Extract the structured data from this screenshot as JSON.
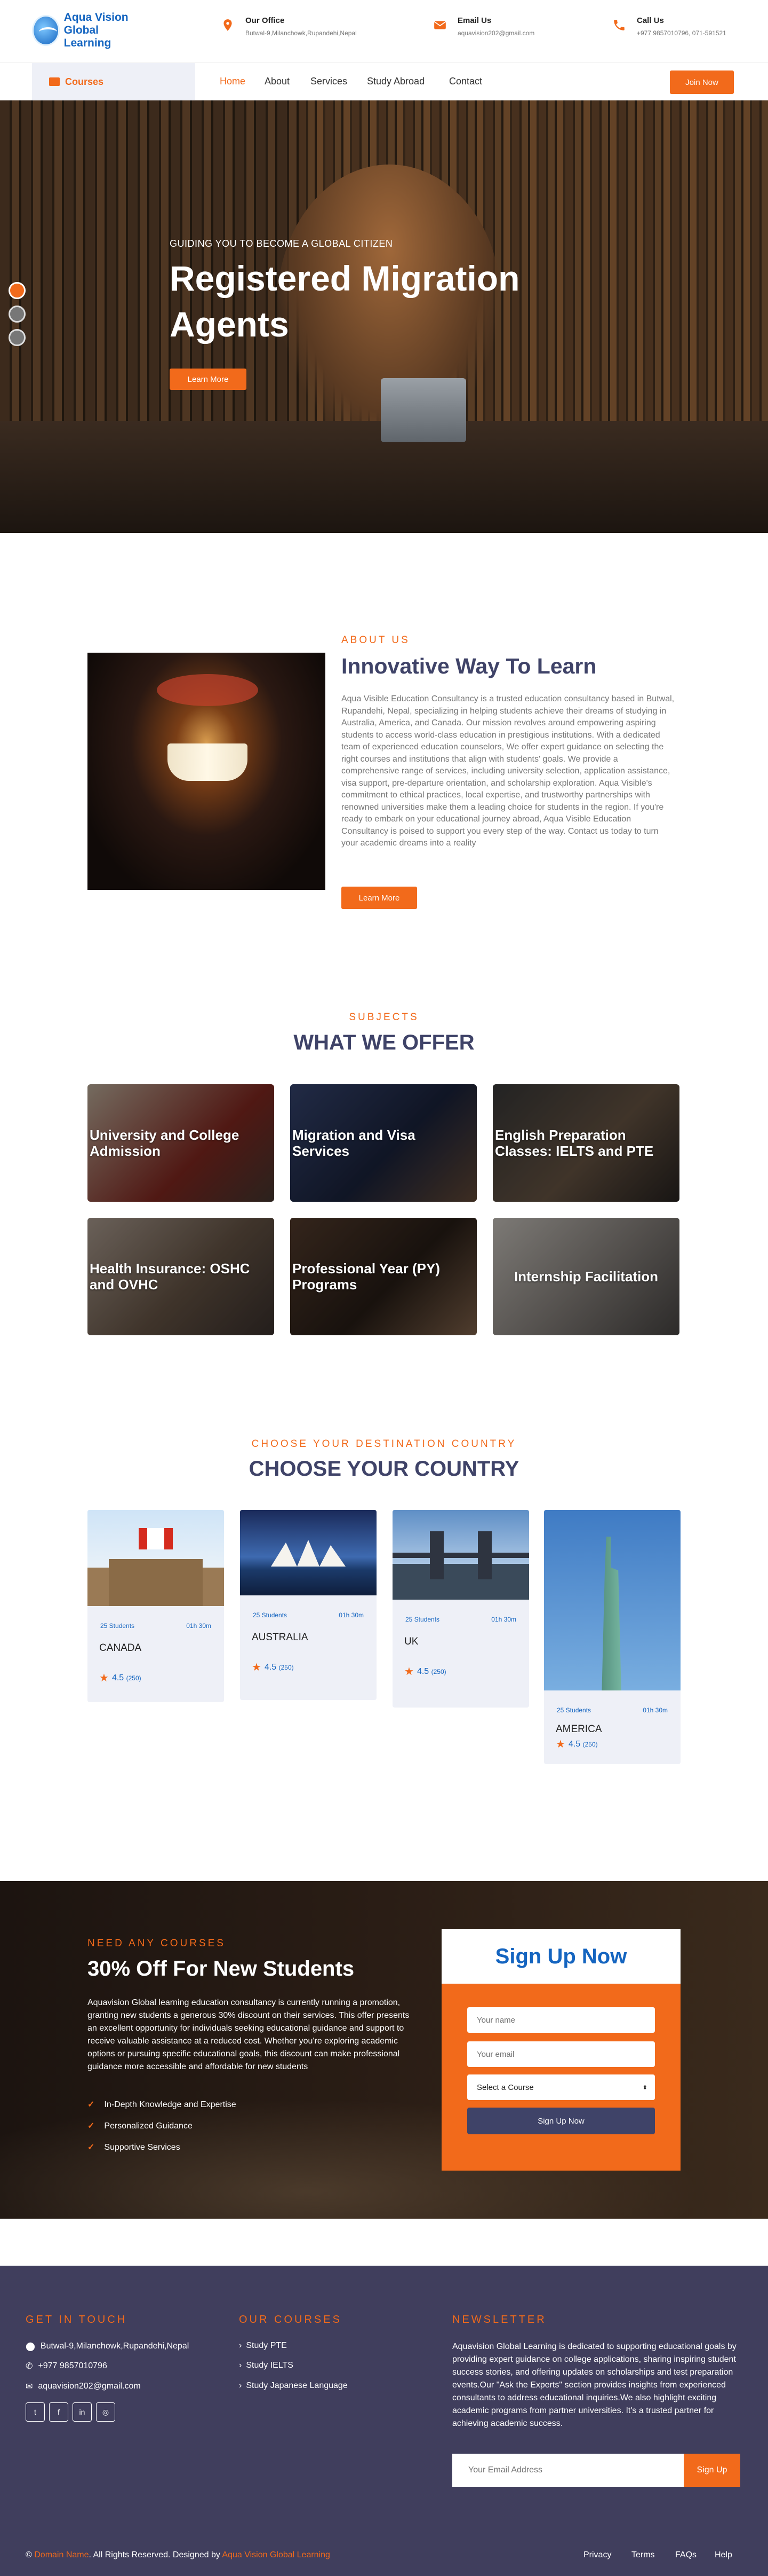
{
  "brand": {
    "name_line1": "Aqua Vision",
    "name_line2": "Global Learning"
  },
  "topbar": {
    "office": {
      "title": "Our Office",
      "value": "Butwal-9,Milanchowk,Rupandehi,Nepal"
    },
    "email": {
      "title": "Email Us",
      "value": "aquavision202@gmail.com"
    },
    "call": {
      "title": "Call Us",
      "value": "+977 9857010796, 071-591521"
    }
  },
  "nav": {
    "courses": "Courses",
    "items": [
      "Home",
      "About",
      "Services",
      "Study Abroad",
      "Contact"
    ],
    "join": "Join Now",
    "colors": {
      "accent": "#f26a1b",
      "brand": "#1565c0",
      "dark": "#403e5d"
    }
  },
  "hero": {
    "subtitle": "GUIDING YOU TO BECOME A GLOBAL CITIZEN",
    "title": "Registered Migration Agents",
    "button": "Learn More",
    "slide_count": 3,
    "active_slide": 1
  },
  "about": {
    "tag": "ABOUT US",
    "title": "Innovative Way To Learn",
    "text": "Aqua Visible Education Consultancy is a trusted education consultancy based in Butwal, Rupandehi, Nepal, specializing in helping students achieve their dreams of studying in Australia, America, and Canada. Our mission revolves around empowering aspiring students to access world-class education in prestigious institutions. With a dedicated team of experienced education counselors, We offer expert guidance on selecting the right courses and institutions that align with students' goals. We provide a comprehensive range of services, including university selection, application assistance, visa support, pre-departure orientation, and scholarship exploration. Aqua Visible's commitment to ethical practices, local expertise, and trustworthy partnerships with renowned universities make them a leading choice for students in the region. If you're ready to embark on your educational journey abroad, Aqua Visible Education Consultancy is poised to support you every step of the way. Contact us today to turn your academic dreams into a reality",
    "button": "Learn More"
  },
  "offer": {
    "tag": "SUBJECTS",
    "title": "WHAT WE OFFER",
    "cards": [
      {
        "label": "University and College Admission"
      },
      {
        "label": "Migration and Visa Services"
      },
      {
        "label": "English Preparation Classes: IELTS and PTE"
      },
      {
        "label": "Health Insurance: OSHC and OVHC"
      },
      {
        "label": "Professional Year (PY) Programs"
      },
      {
        "label": "Internship Facilitation"
      }
    ]
  },
  "countries": {
    "tag": "CHOOSE YOUR DESTINATION COUNTRY",
    "title": "CHOOSE YOUR COUNTRY",
    "cards": [
      {
        "name": "CANADA",
        "students": "25 Students",
        "duration": "01h 30m",
        "rating": "4.5",
        "reviews": "(250)"
      },
      {
        "name": "AUSTRALIA",
        "students": "25 Students",
        "duration": "01h 30m",
        "rating": "4.5",
        "reviews": "(250)"
      },
      {
        "name": "UK",
        "students": "25 Students",
        "duration": "01h 30m",
        "rating": "4.5",
        "reviews": "(250)"
      },
      {
        "name": "AMERICA",
        "students": "25 Students",
        "duration": "01h 30m",
        "rating": "4.5",
        "reviews": "(250)"
      }
    ]
  },
  "promo": {
    "tag": "NEED ANY COURSES",
    "title": "30% Off For New Students",
    "text": "Aquavision Global learning education consultancy is currently running a promotion, granting new students a generous 30% discount on their services. This offer presents an excellent opportunity for individuals seeking educational guidance and support to receive valuable assistance at a reduced cost. Whether you're exploring academic options or pursuing specific educational goals, this discount can make professional guidance more accessible and affordable for new students",
    "features": [
      "In-Depth Knowledge and Expertise",
      "Personalized Guidance",
      "Supportive Services"
    ]
  },
  "signup": {
    "title": "Sign Up Now",
    "name_placeholder": "Your name",
    "email_placeholder": "Your email",
    "course_select": "Select a Course",
    "button": "Sign Up Now"
  },
  "footer": {
    "touch_tag": "GET IN TOUCH",
    "address": "Butwal-9,Milanchowk,Rupandehi,Nepal",
    "phone": "+977 9857010796",
    "email": "aquavision202@gmail.com",
    "courses_tag": "OUR COURSES",
    "courses": [
      "Study PTE",
      "Study IELTS",
      "Study Japanese Language"
    ],
    "news_tag": "NEWSLETTER",
    "news_text": "Aquavision Global Learning is dedicated to supporting educational goals by providing expert guidance on college applications, sharing inspiring student success stories, and offering updates on scholarships and test preparation events.Our \"Ask the Experts\" section provides insights from experienced consultants to address educational inquiries.We also highlight exciting academic programs from partner universities. It's a trusted partner for achieving academic success.",
    "news_placeholder": "Your Email Address",
    "news_button": "Sign Up",
    "copy_domain": "Domain Name",
    "copy_mid": ". All Rights Reserved. Designed by",
    "copy_designer": "Aqua Vision Global Learning",
    "links": [
      "Privacy",
      "Terms",
      "FAQs",
      "Help"
    ]
  }
}
